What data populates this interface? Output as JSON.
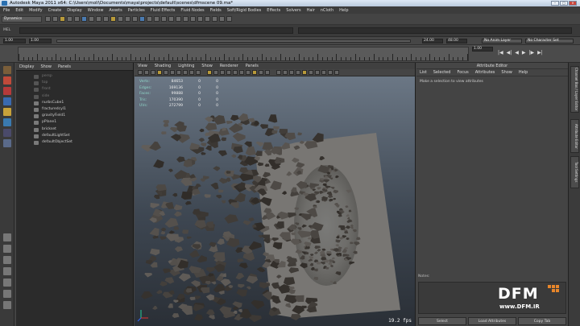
{
  "window": {
    "title": "Autodesk Maya 2011 x64: C:\\Users\\moli\\Documents\\maya\\projects\\default\\scenes\\dfmscene 09.ma*"
  },
  "menubar": [
    "File",
    "Edit",
    "Modify",
    "Create",
    "Display",
    "Window",
    "Assets",
    "Particles",
    "Fluid Effects",
    "Fluid Nodes",
    "Fields",
    "Soft/Rigid Bodies",
    "Effects",
    "Solvers",
    "Hair",
    "nCloth",
    "Help"
  ],
  "statusline": {
    "mode": "Dynamics"
  },
  "shelf": {
    "label": "MEL"
  },
  "range": {
    "start": "1.00",
    "start2": "1.00",
    "end": "24.00",
    "end2": "48.00",
    "anim_layer": "No Anim Layer",
    "char_set": "No Character Set"
  },
  "timeline": {
    "current": "1.00"
  },
  "outliner": {
    "menu": [
      "Display",
      "Show",
      "Panels"
    ],
    "items": [
      {
        "label": "persp",
        "dim": true
      },
      {
        "label": "top",
        "dim": true
      },
      {
        "label": "front",
        "dim": true
      },
      {
        "label": "side",
        "dim": true
      },
      {
        "label": "nurbsCube1",
        "dim": false
      },
      {
        "label": "fracturedcyl1",
        "dim": false
      },
      {
        "label": "gravityField1",
        "dim": false
      },
      {
        "label": "pPlane1",
        "dim": false
      },
      {
        "label": "brickset",
        "dim": false
      },
      {
        "label": "defaultLightSet",
        "dim": false
      },
      {
        "label": "defaultObjectSet",
        "dim": false
      }
    ]
  },
  "viewport": {
    "menu": [
      "View",
      "Shading",
      "Lighting",
      "Show",
      "Renderer",
      "Panels"
    ],
    "hud": [
      {
        "label": "Verts:",
        "value": "84653",
        "a": "0",
        "b": "0"
      },
      {
        "label": "Edges:",
        "value": "169136",
        "a": "0",
        "b": "0"
      },
      {
        "label": "Faces:",
        "value": "99888",
        "a": "0",
        "b": "0"
      },
      {
        "label": "Tris:",
        "value": "170390",
        "a": "0",
        "b": "0"
      },
      {
        "label": "UVs:",
        "value": "272799",
        "a": "0",
        "b": "0"
      }
    ],
    "fps": "19.2 fps"
  },
  "attribute_editor": {
    "title": "Attribute Editor",
    "menu": [
      "List",
      "Selected",
      "Focus",
      "Attributes",
      "Show",
      "Help"
    ],
    "message": "Make a selection to view attributes",
    "notes_label": "Notes:",
    "buttons": [
      "Select",
      "Load Attributes",
      "Copy Tab"
    ]
  },
  "side_tabs": [
    "Channel Box / Layer Editor",
    "Attribute Editor",
    "Tool Settings"
  ],
  "watermark": {
    "brand": "DFM",
    "url": "www.DFM.IR"
  },
  "colors": {
    "accent_orange": "#e8862a",
    "hud_label": "#8fd6c8",
    "bg_dark": "#2b2b2b"
  }
}
